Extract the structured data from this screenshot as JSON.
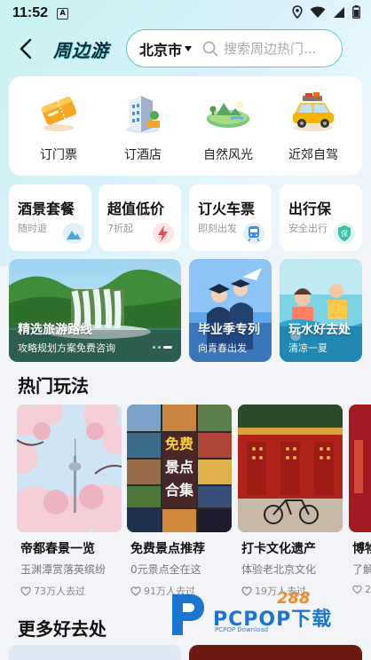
{
  "status": {
    "time": "11:52",
    "a_badge": "A"
  },
  "header": {
    "title": "周边游",
    "city": "北京市",
    "search_placeholder": "搜索周边热门..."
  },
  "categories": [
    {
      "label": "订门票",
      "icon": "ticket-icon"
    },
    {
      "label": "订酒店",
      "icon": "hotel-icon"
    },
    {
      "label": "自然风光",
      "icon": "nature-icon"
    },
    {
      "label": "近郊自驾",
      "icon": "car-icon"
    }
  ],
  "services": [
    {
      "title": "酒景套餐",
      "sub": "随时退",
      "icon": "mountain-icon"
    },
    {
      "title": "超值低价",
      "sub": "7折起",
      "icon": "lightning-icon"
    },
    {
      "title": "订火车票",
      "sub": "即刻出发",
      "icon": "train-icon"
    },
    {
      "title": "出行保",
      "sub": "安全出行",
      "icon": "shield-icon"
    }
  ],
  "banners": [
    {
      "title": "精选旅游路线",
      "sub": "攻略规划方案免费咨询"
    },
    {
      "title": "毕业季专列",
      "sub": "向青春出发"
    },
    {
      "title": "玩水好去处",
      "sub": "清凉一夏"
    }
  ],
  "hot": {
    "section_title": "热门玩法",
    "items": [
      {
        "title": "帝都春景一览",
        "sub": "玉渊潭赏落英缤纷",
        "views": "73万人去过"
      },
      {
        "title": "免费景点推荐",
        "sub": "0元景点全在这",
        "views": "91万人去过",
        "overlay": [
          "免费",
          "景点",
          "合集"
        ]
      },
      {
        "title": "打卡文化遗产",
        "sub": "体验老北京文化",
        "views": "19万人去过"
      },
      {
        "title": "博物",
        "sub": "了解",
        "views": "2"
      }
    ]
  },
  "more": {
    "section_title": "更多好去处"
  },
  "watermark": {
    "brand": "PCPOP下载",
    "sub": "PCPOP Download",
    "tag": "288"
  },
  "colors": {
    "accent": "#5cc9c0",
    "title": "#062c3d",
    "background": "#f2f4f7"
  }
}
